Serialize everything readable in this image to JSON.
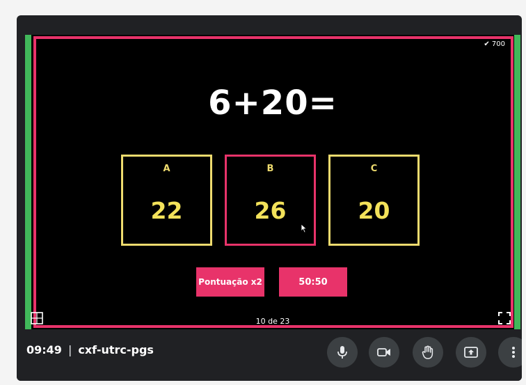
{
  "quiz": {
    "question": "6+20=",
    "answers": [
      {
        "letter": "A",
        "value": "22",
        "selected": false
      },
      {
        "letter": "B",
        "value": "26",
        "selected": true
      },
      {
        "letter": "C",
        "value": "20",
        "selected": false
      }
    ],
    "powerups": {
      "double_points": "Pontuação x2",
      "fifty_fifty": "50:50"
    },
    "progress": "10 de 23",
    "top_status": "✔ 700"
  },
  "meeting": {
    "time": "09:49",
    "separator": "|",
    "code": "cxf-utrc-pgs"
  },
  "controls": [
    {
      "name": "microphone-button",
      "icon": "microphone-icon"
    },
    {
      "name": "camera-button",
      "icon": "camera-icon"
    },
    {
      "name": "raise-hand-button",
      "icon": "hand-icon"
    },
    {
      "name": "present-screen-button",
      "icon": "present-icon"
    },
    {
      "name": "more-options-button",
      "icon": "more-vertical-icon"
    }
  ],
  "colors": {
    "accent_pink": "#e8336a",
    "answer_yellow": "#eedb6e",
    "frame_green": "#41b85a",
    "toolbar_bg": "#202124",
    "control_bg": "#3c4043"
  }
}
